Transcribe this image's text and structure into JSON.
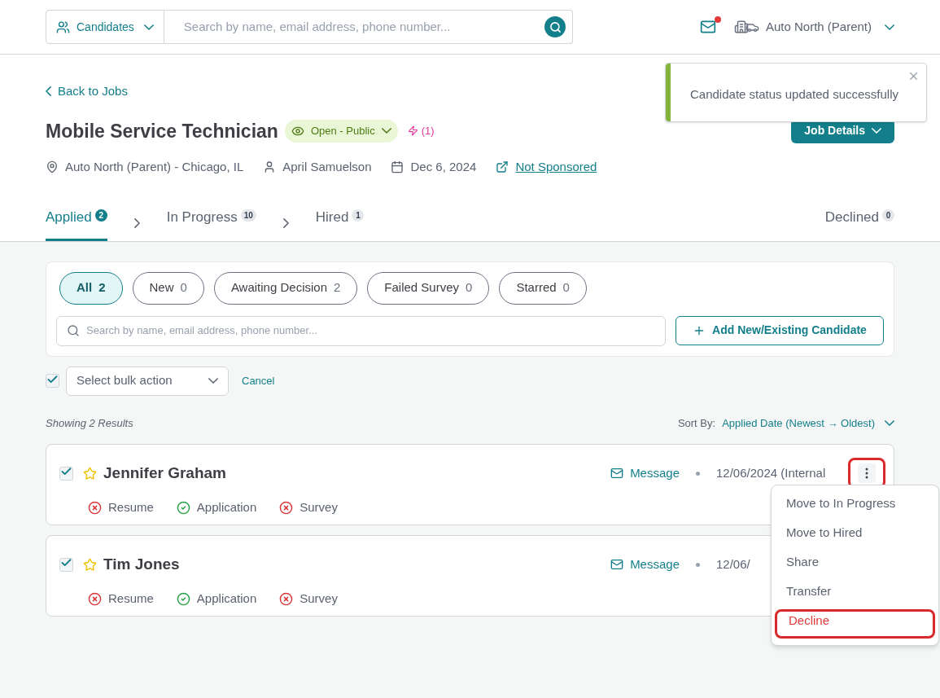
{
  "header": {
    "scope": "Candidates",
    "search": {
      "placeholder": "Search by name, email address, phone number..."
    },
    "unread": true,
    "account": "Auto North (Parent)"
  },
  "toast": {
    "message": "Candidate status updated successfully",
    "kind": "success"
  },
  "back_link": "Back to Jobs",
  "job": {
    "title": "Mobile Service Technician",
    "status": "Open - Public",
    "boost": "(1)",
    "location": "Auto North (Parent) - Chicago, IL",
    "recruiter": "April Samuelson",
    "date": "Dec 6, 2024",
    "sponsor": "Not Sponsored",
    "details_button": "Job Details"
  },
  "stages": [
    {
      "label": "Applied",
      "count": "2",
      "selected": true,
      "kind": "step"
    },
    {
      "label": "In Progress",
      "count": "10",
      "selected": false,
      "kind": "step"
    },
    {
      "label": "Hired",
      "count": "1",
      "selected": false,
      "kind": "step"
    },
    {
      "label": "Declined",
      "count": "0",
      "selected": false,
      "kind": "end"
    }
  ],
  "filters": [
    {
      "label": "All",
      "count": "2",
      "selected": true
    },
    {
      "label": "New",
      "count": "0",
      "selected": false
    },
    {
      "label": "Awaiting Decision",
      "count": "2",
      "selected": false
    },
    {
      "label": "Failed Survey",
      "count": "0",
      "selected": false
    },
    {
      "label": "Starred",
      "count": "0",
      "selected": false
    }
  ],
  "candidate_search": {
    "placeholder": "Search by name, email address, phone number..."
  },
  "add_button": "Add New/Existing Candidate",
  "bulk": {
    "checked": true,
    "placeholder": "Select bulk action",
    "cancel": "Cancel"
  },
  "results_text": "Showing 2 Results",
  "sort": {
    "label": "Sort By:",
    "value": "Applied Date (Newest → Oldest)"
  },
  "candidates": [
    {
      "name": "Jennifer Graham",
      "checked": true,
      "starred": false,
      "message": "Message",
      "date": "12/06/2024 (Internal",
      "menu_highlighted": true,
      "documents": [
        {
          "label": "Resume",
          "kind": "fail"
        },
        {
          "label": "Application",
          "kind": "pass"
        },
        {
          "label": "Survey",
          "kind": "fail"
        }
      ]
    },
    {
      "name": "Tim Jones",
      "checked": true,
      "starred": false,
      "message": "Message",
      "date": "12/06/",
      "documents": [
        {
          "label": "Resume",
          "kind": "fail"
        },
        {
          "label": "Application",
          "kind": "pass"
        },
        {
          "label": "Survey",
          "kind": "fail"
        }
      ]
    }
  ],
  "action_menu": {
    "items": [
      {
        "label": "Move to In Progress",
        "kind": "normal",
        "highlighted": false
      },
      {
        "label": "Move to Hired",
        "kind": "normal",
        "highlighted": false
      },
      {
        "label": "Share",
        "kind": "normal",
        "highlighted": false
      },
      {
        "label": "Transfer",
        "kind": "normal",
        "highlighted": false
      },
      {
        "label": "Decline",
        "kind": "danger",
        "highlighted": true
      }
    ]
  }
}
